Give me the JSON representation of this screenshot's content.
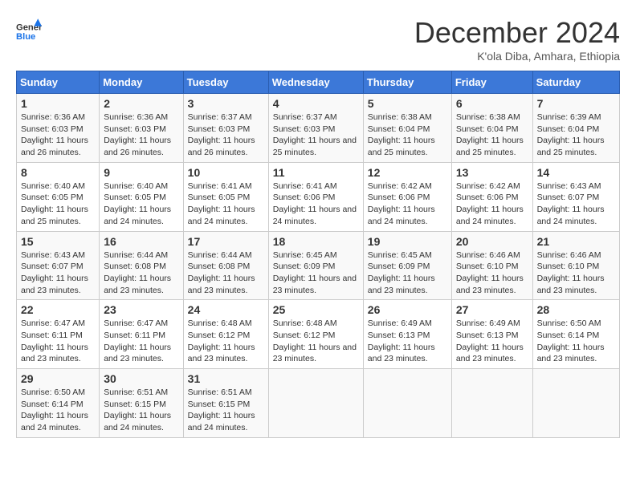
{
  "header": {
    "logo_line1": "General",
    "logo_line2": "Blue",
    "month_title": "December 2024",
    "location": "K'ola Diba, Amhara, Ethiopia"
  },
  "weekdays": [
    "Sunday",
    "Monday",
    "Tuesday",
    "Wednesday",
    "Thursday",
    "Friday",
    "Saturday"
  ],
  "weeks": [
    [
      {
        "day": "1",
        "sunrise": "6:36 AM",
        "sunset": "6:03 PM",
        "daylight": "11 hours and 26 minutes."
      },
      {
        "day": "2",
        "sunrise": "6:36 AM",
        "sunset": "6:03 PM",
        "daylight": "11 hours and 26 minutes."
      },
      {
        "day": "3",
        "sunrise": "6:37 AM",
        "sunset": "6:03 PM",
        "daylight": "11 hours and 26 minutes."
      },
      {
        "day": "4",
        "sunrise": "6:37 AM",
        "sunset": "6:03 PM",
        "daylight": "11 hours and 25 minutes."
      },
      {
        "day": "5",
        "sunrise": "6:38 AM",
        "sunset": "6:04 PM",
        "daylight": "11 hours and 25 minutes."
      },
      {
        "day": "6",
        "sunrise": "6:38 AM",
        "sunset": "6:04 PM",
        "daylight": "11 hours and 25 minutes."
      },
      {
        "day": "7",
        "sunrise": "6:39 AM",
        "sunset": "6:04 PM",
        "daylight": "11 hours and 25 minutes."
      }
    ],
    [
      {
        "day": "8",
        "sunrise": "6:40 AM",
        "sunset": "6:05 PM",
        "daylight": "11 hours and 25 minutes."
      },
      {
        "day": "9",
        "sunrise": "6:40 AM",
        "sunset": "6:05 PM",
        "daylight": "11 hours and 24 minutes."
      },
      {
        "day": "10",
        "sunrise": "6:41 AM",
        "sunset": "6:05 PM",
        "daylight": "11 hours and 24 minutes."
      },
      {
        "day": "11",
        "sunrise": "6:41 AM",
        "sunset": "6:06 PM",
        "daylight": "11 hours and 24 minutes."
      },
      {
        "day": "12",
        "sunrise": "6:42 AM",
        "sunset": "6:06 PM",
        "daylight": "11 hours and 24 minutes."
      },
      {
        "day": "13",
        "sunrise": "6:42 AM",
        "sunset": "6:06 PM",
        "daylight": "11 hours and 24 minutes."
      },
      {
        "day": "14",
        "sunrise": "6:43 AM",
        "sunset": "6:07 PM",
        "daylight": "11 hours and 24 minutes."
      }
    ],
    [
      {
        "day": "15",
        "sunrise": "6:43 AM",
        "sunset": "6:07 PM",
        "daylight": "11 hours and 23 minutes."
      },
      {
        "day": "16",
        "sunrise": "6:44 AM",
        "sunset": "6:08 PM",
        "daylight": "11 hours and 23 minutes."
      },
      {
        "day": "17",
        "sunrise": "6:44 AM",
        "sunset": "6:08 PM",
        "daylight": "11 hours and 23 minutes."
      },
      {
        "day": "18",
        "sunrise": "6:45 AM",
        "sunset": "6:09 PM",
        "daylight": "11 hours and 23 minutes."
      },
      {
        "day": "19",
        "sunrise": "6:45 AM",
        "sunset": "6:09 PM",
        "daylight": "11 hours and 23 minutes."
      },
      {
        "day": "20",
        "sunrise": "6:46 AM",
        "sunset": "6:10 PM",
        "daylight": "11 hours and 23 minutes."
      },
      {
        "day": "21",
        "sunrise": "6:46 AM",
        "sunset": "6:10 PM",
        "daylight": "11 hours and 23 minutes."
      }
    ],
    [
      {
        "day": "22",
        "sunrise": "6:47 AM",
        "sunset": "6:11 PM",
        "daylight": "11 hours and 23 minutes."
      },
      {
        "day": "23",
        "sunrise": "6:47 AM",
        "sunset": "6:11 PM",
        "daylight": "11 hours and 23 minutes."
      },
      {
        "day": "24",
        "sunrise": "6:48 AM",
        "sunset": "6:12 PM",
        "daylight": "11 hours and 23 minutes."
      },
      {
        "day": "25",
        "sunrise": "6:48 AM",
        "sunset": "6:12 PM",
        "daylight": "11 hours and 23 minutes."
      },
      {
        "day": "26",
        "sunrise": "6:49 AM",
        "sunset": "6:13 PM",
        "daylight": "11 hours and 23 minutes."
      },
      {
        "day": "27",
        "sunrise": "6:49 AM",
        "sunset": "6:13 PM",
        "daylight": "11 hours and 23 minutes."
      },
      {
        "day": "28",
        "sunrise": "6:50 AM",
        "sunset": "6:14 PM",
        "daylight": "11 hours and 23 minutes."
      }
    ],
    [
      {
        "day": "29",
        "sunrise": "6:50 AM",
        "sunset": "6:14 PM",
        "daylight": "11 hours and 24 minutes."
      },
      {
        "day": "30",
        "sunrise": "6:51 AM",
        "sunset": "6:15 PM",
        "daylight": "11 hours and 24 minutes."
      },
      {
        "day": "31",
        "sunrise": "6:51 AM",
        "sunset": "6:15 PM",
        "daylight": "11 hours and 24 minutes."
      },
      null,
      null,
      null,
      null
    ]
  ]
}
